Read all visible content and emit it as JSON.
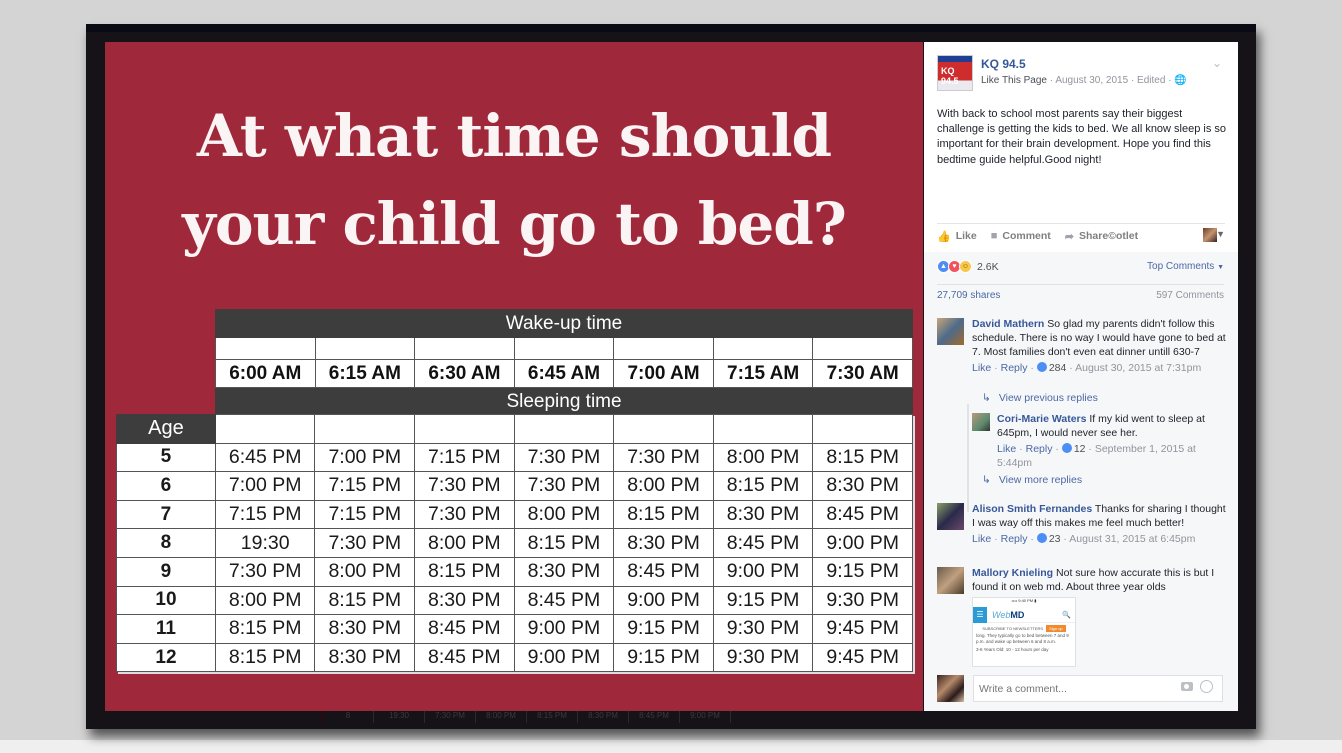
{
  "slide": {
    "title_line1": "At what time should",
    "title_line2": "your child go to bed?",
    "colors": {
      "background": "#a0283b",
      "band": "#3e3d3d"
    },
    "table": {
      "wake_header": "Wake-up time",
      "wake_times": [
        "6:00 AM",
        "6:15 AM",
        "6:30 AM",
        "6:45 AM",
        "7:00 AM",
        "7:15 AM",
        "7:30 AM"
      ],
      "sleep_header": "Sleeping time",
      "age_header": "Age",
      "rows": [
        {
          "age": "5",
          "times": [
            "6:45 PM",
            "7:00 PM",
            "7:15 PM",
            "7:30 PM",
            "7:30 PM",
            "8:00 PM",
            "8:15 PM"
          ]
        },
        {
          "age": "6",
          "times": [
            "7:00 PM",
            "7:15 PM",
            "7:30 PM",
            "7:30 PM",
            "8:00 PM",
            "8:15 PM",
            "8:30 PM"
          ]
        },
        {
          "age": "7",
          "times": [
            "7:15 PM",
            "7:15 PM",
            "7:30 PM",
            "8:00 PM",
            "8:15 PM",
            "8:30 PM",
            "8:45 PM"
          ]
        },
        {
          "age": "8",
          "times": [
            "19:30",
            "7:30 PM",
            "8:00 PM",
            "8:15 PM",
            "8:30 PM",
            "8:45 PM",
            "9:00 PM"
          ]
        },
        {
          "age": "9",
          "times": [
            "7:30 PM",
            "8:00 PM",
            "8:15 PM",
            "8:30 PM",
            "8:45 PM",
            "9:00 PM",
            "9:15 PM"
          ]
        },
        {
          "age": "10",
          "times": [
            "8:00 PM",
            "8:15 PM",
            "8:30 PM",
            "8:45 PM",
            "9:00 PM",
            "9:15 PM",
            "9:30 PM"
          ]
        },
        {
          "age": "11",
          "times": [
            "8:15 PM",
            "8:30 PM",
            "8:45 PM",
            "9:00 PM",
            "9:15 PM",
            "9:30 PM",
            "9:45 PM"
          ]
        },
        {
          "age": "12",
          "times": [
            "8:15 PM",
            "8:30 PM",
            "8:45 PM",
            "9:00 PM",
            "9:15 PM",
            "9:30 PM",
            "9:45 PM"
          ]
        }
      ]
    },
    "ghost_row": [
      "8",
      "19:30",
      "7:30 PM",
      "8:00 PM",
      "8:15 PM",
      "8:30 PM",
      "8:45 PM",
      "9:00 PM"
    ]
  },
  "post": {
    "page_name": "KQ 94.5",
    "logo_text": "KQ 94.5",
    "like_page": "Like This Page",
    "date": "August 30, 2015",
    "edited": "Edited",
    "text": "With back to school most parents say their biggest challenge is getting the kids to bed. We all know sleep is so important for their brain development. Hope you find this bedtime guide helpful.Good night!",
    "actions": {
      "like": "Like",
      "comment": "Comment",
      "share": "Share",
      "extra": "©otlet"
    },
    "reaction_count": "2.6K",
    "top_comments": "Top Comments",
    "shares": "27,709 shares",
    "comments_count": "597 Comments",
    "comments": [
      {
        "author": "David Mathern",
        "text": "So glad my parents didn't follow this schedule. There is no way I would have gone to bed at 7. Most families don't even eat dinner untill 630-7",
        "like": "Like",
        "reply": "Reply",
        "likes": "284",
        "time": "August 30, 2015 at 7:31pm"
      },
      {
        "author": "Cori-Marie Waters",
        "text": "If my kid went to sleep at 645pm, I would never see her.",
        "like": "Like",
        "reply": "Reply",
        "likes": "12",
        "time": "September 1, 2015 at 5:44pm"
      },
      {
        "author": "Alison Smith Fernandes",
        "text": "Thanks for sharing I thought I was way off this makes me feel much better!",
        "like": "Like",
        "reply": "Reply",
        "likes": "23",
        "time": "August 31, 2015 at 6:45pm"
      },
      {
        "author": "Mallory Knieling",
        "text": "Not sure how accurate this is but I found it on web md. About three year olds"
      }
    ],
    "view_previous_replies": "View previous replies",
    "view_more_replies": "View more replies",
    "webmd": {
      "logo_a": "Web",
      "logo_b": "MD",
      "newsletter": "SUBSCRIBE TO NEWSLETTERS",
      "signup": "Sign up",
      "text": "long. They typically go to bed between 7 and 9 p.m. and wake up between 6 and 8 a.m.",
      "text2": "3-6 Years Old: 10 - 12 hours per day"
    },
    "write_comment_placeholder": "Write a comment..."
  }
}
